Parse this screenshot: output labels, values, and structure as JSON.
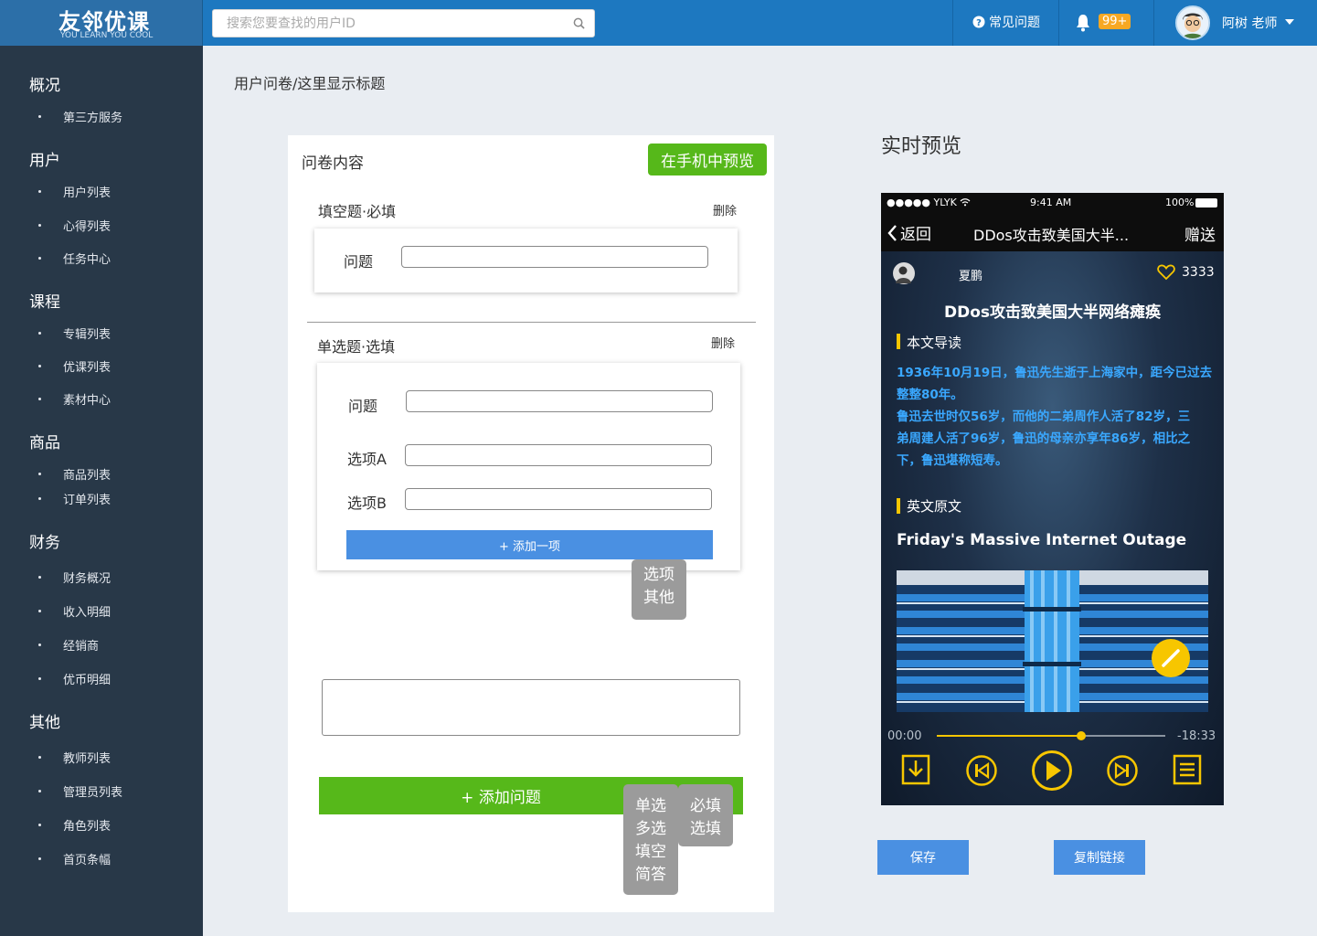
{
  "header": {
    "logo_main": "友邻优课",
    "logo_sub": "YOU LEARN YOU COOL",
    "search_placeholder": "搜索您要查找的用户ID",
    "faq_label": "常见问题",
    "notification_badge": "99+",
    "user_name": "阿树 老师"
  },
  "sidebar": {
    "groups": [
      {
        "title": "概况",
        "items": [
          "第三方服务"
        ]
      },
      {
        "title": "用户",
        "items": [
          "用户列表",
          "心得列表",
          "任务中心"
        ]
      },
      {
        "title": "课程",
        "items": [
          "专辑列表",
          "优课列表",
          "素材中心"
        ]
      },
      {
        "title": "商品",
        "items": [
          "商品列表",
          "订单列表"
        ]
      },
      {
        "title": "财务",
        "items": [
          "财务概况",
          "收入明细",
          "经销商",
          "优币明细"
        ]
      },
      {
        "title": "其他",
        "items": [
          "教师列表",
          "管理员列表",
          "角色列表",
          "首页条幅"
        ]
      }
    ]
  },
  "main": {
    "breadcrumb": "用户问卷/这里显示标题",
    "card_title": "问卷内容",
    "preview_button": "在手机中预览",
    "q1": {
      "type_label": "填空题·必填",
      "delete": "删除",
      "field_label": "问题"
    },
    "q2": {
      "type_label": "单选题·选填",
      "delete": "删除",
      "field_question": "问题",
      "field_a": "选项A",
      "field_b": "选项B",
      "add_item": "+  添加一项"
    },
    "popup_option": [
      "选项",
      "其他"
    ],
    "add_question": "+  添加问题",
    "popup_types": [
      "单选",
      "多选",
      "填空",
      "简答"
    ],
    "popup_required": [
      "必填",
      "选填"
    ]
  },
  "preview": {
    "title": "实时预览",
    "status": {
      "carrier": "●●●●● YLYK",
      "time": "9:41 AM",
      "battery": "100%"
    },
    "nav": {
      "back": "返回",
      "title": "DDos攻击致美国大半...",
      "gift": "赠送"
    },
    "author": "夏鹏",
    "likes": "3333",
    "article_title": "DDos攻击致美国大半网络瘫痪",
    "intro_heading": "本文导读",
    "intro_lines": [
      "1936年10月19日，鲁迅先生逝于上海家中，距今已过去",
      "整整80年。",
      "鲁迅去世时仅56岁，而他的二弟周作人活了82岁，三",
      "弟周建人活了96岁，鲁迅的母亲亦享年86岁，相比之",
      "下，鲁迅堪称短寿。"
    ],
    "original_heading": "英文原文",
    "english_title": "Friday's Massive Internet Outage",
    "player": {
      "current": "00:00",
      "remaining": "-18:33",
      "progress": 0.63
    },
    "save_button": "保存",
    "copy_button": "复制链接"
  },
  "colors": {
    "topbar": "#1d78c0",
    "sidebar": "#283848",
    "green": "#56b81a",
    "blue_button": "#4a90e2",
    "badge": "#f7a823",
    "accent_yellow": "#f7c600"
  }
}
